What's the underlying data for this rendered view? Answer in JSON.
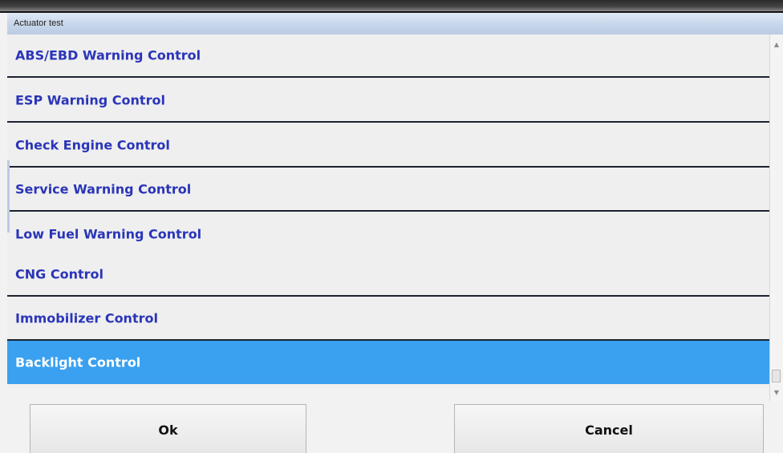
{
  "window": {
    "title": "Actuator test"
  },
  "list": {
    "items": [
      {
        "label": "ABS/EBD Warning Control"
      },
      {
        "label": "ESP Warning Control"
      },
      {
        "label": "Check Engine Control"
      },
      {
        "label": "Service Warning Control"
      },
      {
        "label": "Low Fuel Warning Control"
      },
      {
        "label": "CNG Control"
      },
      {
        "label": "Immobilizer Control"
      },
      {
        "label": "Backlight Control"
      }
    ],
    "selected_label": "Backlight Control"
  },
  "buttons": {
    "ok_label": "Ok",
    "cancel_label": "Cancel"
  },
  "colors": {
    "selection": "#3aa0f0",
    "item_text": "#2a35b8"
  }
}
